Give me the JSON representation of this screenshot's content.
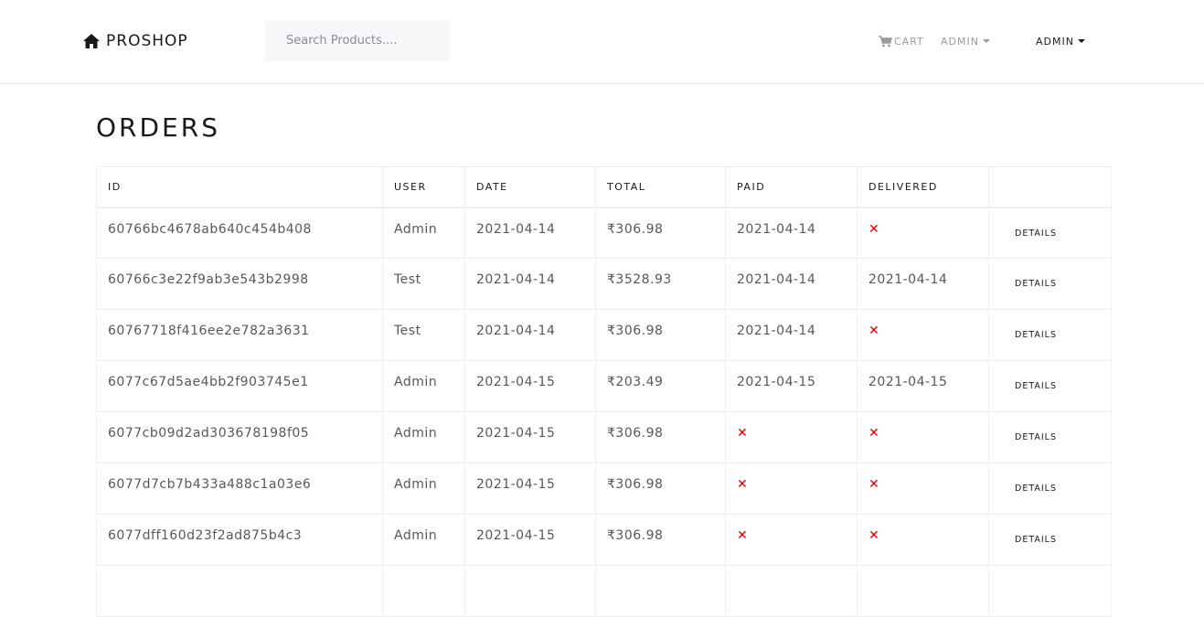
{
  "brand": {
    "name": "PROSHOP",
    "icon": "home-icon"
  },
  "search": {
    "placeholder": "Search Products...."
  },
  "nav": {
    "cart_label": "CART",
    "user_label": "ADMIN",
    "admin_menu_label": "ADMIN"
  },
  "page": {
    "title": "ORDERS"
  },
  "table": {
    "headers": [
      "ID",
      "USER",
      "DATE",
      "TOTAL",
      "PAID",
      "DELIVERED",
      ""
    ],
    "details_label": "DETAILS",
    "rows": [
      {
        "id": "60766bc4678ab640c454b408",
        "user": "Admin",
        "date": "2021-04-14",
        "total": "₹306.98",
        "paid": "2021-04-14",
        "delivered": null
      },
      {
        "id": "60766c3e22f9ab3e543b2998",
        "user": "Test",
        "date": "2021-04-14",
        "total": "₹3528.93",
        "paid": "2021-04-14",
        "delivered": "2021-04-14"
      },
      {
        "id": "60767718f416ee2e782a3631",
        "user": "Test",
        "date": "2021-04-14",
        "total": "₹306.98",
        "paid": "2021-04-14",
        "delivered": null
      },
      {
        "id": "6077c67d5ae4bb2f903745e1",
        "user": "Admin",
        "date": "2021-04-15",
        "total": "₹203.49",
        "paid": "2021-04-15",
        "delivered": "2021-04-15"
      },
      {
        "id": "6077cb09d2ad303678198f05",
        "user": "Admin",
        "date": "2021-04-15",
        "total": "₹306.98",
        "paid": null,
        "delivered": null
      },
      {
        "id": "6077d7cb7b433a488c1a03e6",
        "user": "Admin",
        "date": "2021-04-15",
        "total": "₹306.98",
        "paid": null,
        "delivered": null
      },
      {
        "id": "6077dff160d23f2ad875b4c3",
        "user": "Admin",
        "date": "2021-04-15",
        "total": "₹306.98",
        "paid": null,
        "delivered": null
      },
      {
        "id": "",
        "user": "",
        "date": "",
        "total": "",
        "paid": null,
        "delivered": null
      }
    ]
  },
  "colors": {
    "not_done": "#e30000",
    "text": "#55595c",
    "heading": "#1a1a1a"
  }
}
